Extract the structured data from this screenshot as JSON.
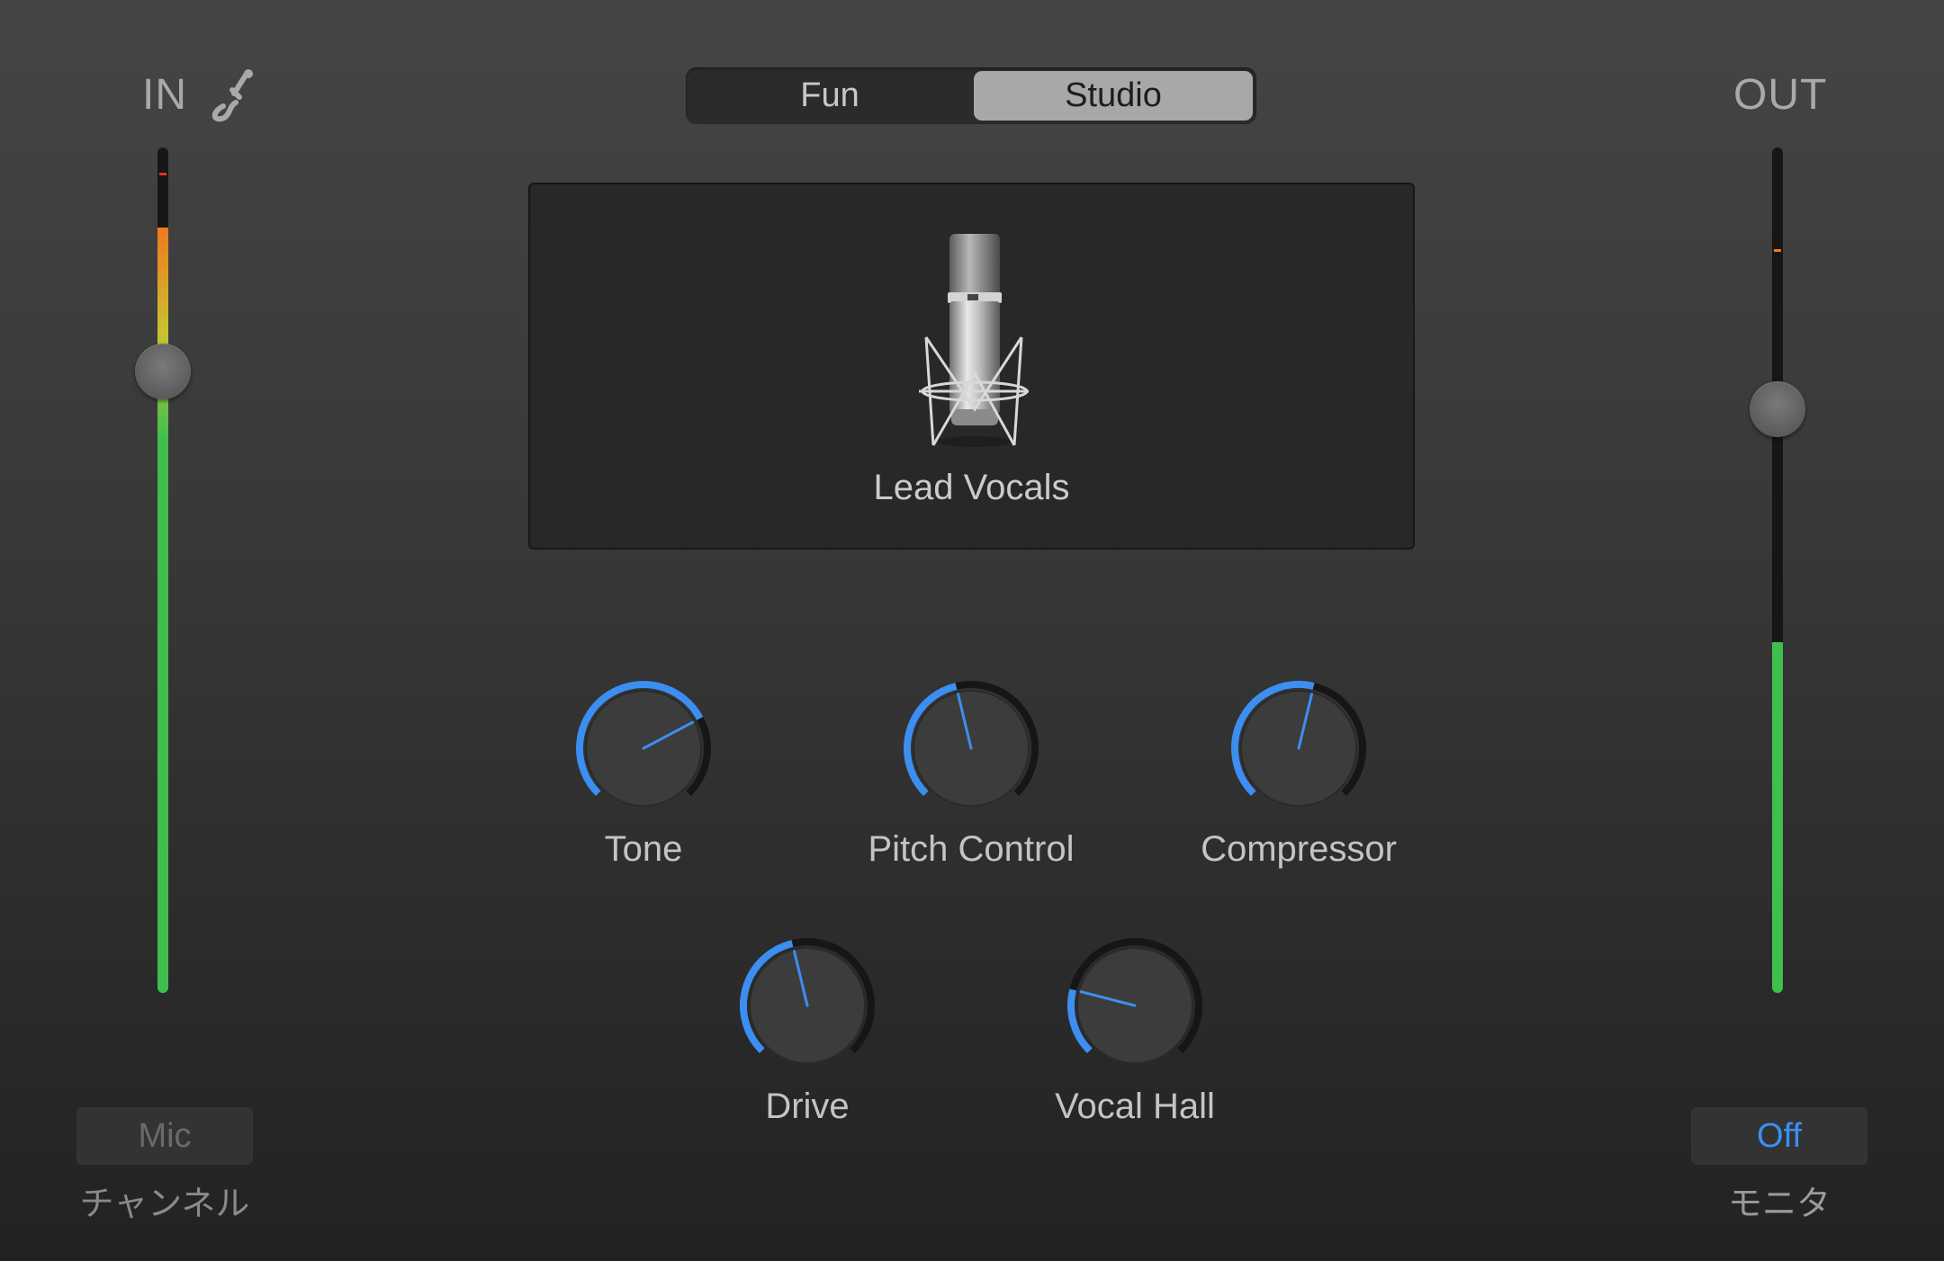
{
  "input": {
    "title": "IN",
    "icon": "guitar-cable-icon",
    "level": 0.905,
    "slider": 0.735,
    "peak": 0.97,
    "source_button": "Mic",
    "source_caption": "チャンネル"
  },
  "output": {
    "title": "OUT",
    "level": 0.415,
    "slider": 0.69,
    "peak": 0.88,
    "monitor_button": "Off",
    "monitor_caption": "モニタ"
  },
  "mode": {
    "options": [
      "Fun",
      "Studio"
    ],
    "selected": "Studio"
  },
  "patch": {
    "name": "Lead Vocals",
    "icon": "studio-microphone-icon"
  },
  "knobs": [
    {
      "label": "Tone",
      "value": 0.73
    },
    {
      "label": "Pitch Control",
      "value": 0.45
    },
    {
      "label": "Compressor",
      "value": 0.55
    },
    {
      "label": "Drive",
      "value": 0.45
    },
    {
      "label": "Vocal Hall",
      "value": 0.22
    }
  ],
  "colors": {
    "accent": "#3c8ff0",
    "meter_green": "#3fbf4d",
    "meter_yellow": "#c8c231",
    "meter_orange": "#ee7a1e",
    "peak_red": "#e0321e"
  }
}
